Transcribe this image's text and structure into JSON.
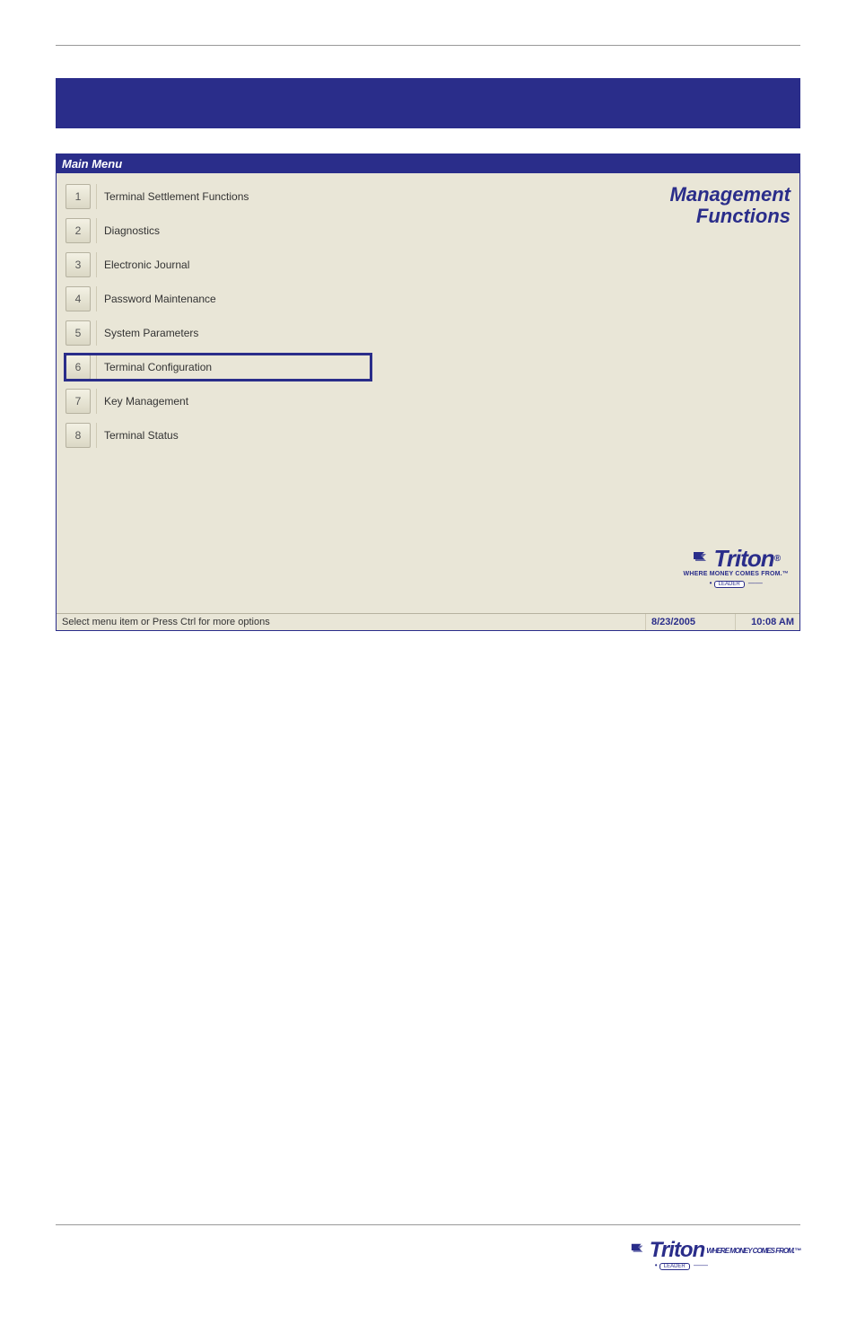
{
  "window": {
    "title": "Main Menu",
    "right_title_line1": "Management",
    "right_title_line2": "Functions",
    "statusbar": {
      "hint": "Select menu item or Press Ctrl for more options",
      "date": "8/23/2005",
      "time": "10:08 AM"
    }
  },
  "menu": {
    "items": [
      {
        "num": "1",
        "label": "Terminal Settlement Functions",
        "highlighted": false
      },
      {
        "num": "2",
        "label": "Diagnostics",
        "highlighted": false
      },
      {
        "num": "3",
        "label": "Electronic Journal",
        "highlighted": false
      },
      {
        "num": "4",
        "label": "Password Maintenance",
        "highlighted": false
      },
      {
        "num": "5",
        "label": "System Parameters",
        "highlighted": false
      },
      {
        "num": "6",
        "label": "Terminal Configuration",
        "highlighted": true
      },
      {
        "num": "7",
        "label": "Key Management",
        "highlighted": false
      },
      {
        "num": "8",
        "label": "Terminal Status",
        "highlighted": false
      }
    ]
  },
  "brand": {
    "name": "Triton",
    "tagline": "WHERE MONEY COMES FROM.™",
    "subpill": "LEADER",
    "reg": "®"
  }
}
